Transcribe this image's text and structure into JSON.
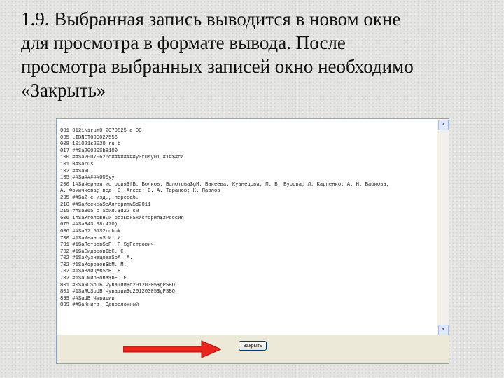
{
  "slide": {
    "heading_lines": [
      "1.9. Выбранная запись выводится в новом окне",
      "для просмотра в формате вывода. После",
      "просмотра выбранных записей окно необходимо",
      "«Закрыть»"
    ]
  },
  "record_window": {
    "lines": [
      "001 0121\\irum0 2070825 c 00",
      "005 LIBNET090027556",
      "008 101021s2020 ru b",
      "017 ##$a20020$b8100",
      "100 ##$a20070626d########y0rusy01 #1#$#ca",
      "101 0#$arus",
      "102 ##$aRU",
      "105 ##$a#####000yy",
      "200 1#$aЧерная история$fВ. Волков; Болотова$gИ. Бакеева; Кузнецова; М. В. Бурова; Л. Карпенко; А. Н. Бабкова,",
      "А. Фомичкова; вед. В. Агеев; В. А. Таранов; К. Павлов",
      "205 ##$a2-е изд., перераб.",
      "210 ##$aМосква$cАлгоритм$d2011",
      "215 ##$a365 с.$cил.$d22 см",
      "606 1#$aУголовный розыск$xИстория$zРоссия",
      "675 ##$a343.98(470)",
      "686 ##$a67.51$2rubbk",
      "700 #1$aИванов$bИ. И.",
      "701 #1$aПетров$bП. П.$gПетрович",
      "702 #1$aСидоров$bС. С.",
      "702 #1$aКузнецова$bА. А.",
      "702 #1$aМорозов$bМ. М.",
      "702 #1$aЗайцев$bВ. В.",
      "702 #1$aСмирнова$bЕ. Е.",
      "801 #0$aRU$bЦБ Чувашии$c20120305$gPSBO",
      "801 #1$aRU$bЦБ Чувашии$c20120305$gPSBO",
      "899 ##$aЦБ Чувашии",
      "899 ##$aКнига. Односложный"
    ],
    "close_label": "Закрыть"
  },
  "colors": {
    "arrow": "#e8241b",
    "window_border": "#8ba4c8",
    "footer": "#ece9d8"
  },
  "icons": {
    "scroll_up": "triangle-up-icon",
    "scroll_down": "triangle-down-icon",
    "pointer": "red-arrow-icon"
  }
}
